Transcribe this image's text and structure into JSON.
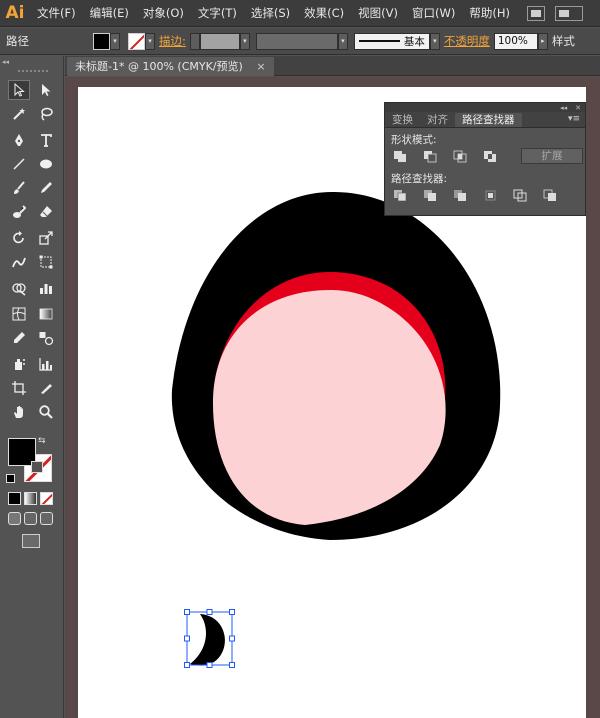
{
  "app": {
    "logo": "Ai"
  },
  "menu": {
    "items": [
      "文件(F)",
      "编辑(E)",
      "对象(O)",
      "文字(T)",
      "选择(S)",
      "效果(C)",
      "视图(V)",
      "窗口(W)",
      "帮助(H)"
    ]
  },
  "control_bar": {
    "selection_type": "路径",
    "stroke_label": "描边:",
    "stroke_profile": "基本",
    "opacity_label": "不透明度",
    "opacity_value": "100%",
    "style_label": "样式"
  },
  "document": {
    "tab_title": "未标题-1* @ 100% (CMYK/预览)",
    "close_glyph": "×"
  },
  "panel": {
    "tabs": [
      "变换",
      "对齐",
      "路径查找器"
    ],
    "active_tab": "路径查找器",
    "shape_modes_label": "形状模式:",
    "pathfinders_label": "路径查找器:",
    "expand_label": "扩展"
  },
  "colors": {
    "accent": "#f2a33a",
    "artwork_black": "#000000",
    "artwork_red": "#e4001b",
    "artwork_pink": "#fcd2d4",
    "selection_blue": "#1e5bff"
  },
  "icons": {
    "tools": [
      "selection-tool-icon",
      "direct-selection-tool-icon",
      "magic-wand-icon",
      "lasso-icon",
      "pen-tool-icon",
      "type-tool-icon",
      "line-tool-icon",
      "ellipse-tool-icon",
      "paintbrush-icon",
      "pencil-icon",
      "blob-brush-icon",
      "eraser-icon",
      "rotate-tool-icon",
      "scale-tool-icon",
      "warp-tool-icon",
      "free-transform-icon",
      "shape-builder-icon",
      "chart-tool-icon",
      "mesh-tool-icon",
      "gradient-tool-icon",
      "eyedropper-icon",
      "blend-tool-icon",
      "symbol-sprayer-icon",
      "column-graph-icon",
      "artboard-tool-icon",
      "slice-tool-icon",
      "hand-tool-icon",
      "zoom-tool-icon"
    ]
  }
}
